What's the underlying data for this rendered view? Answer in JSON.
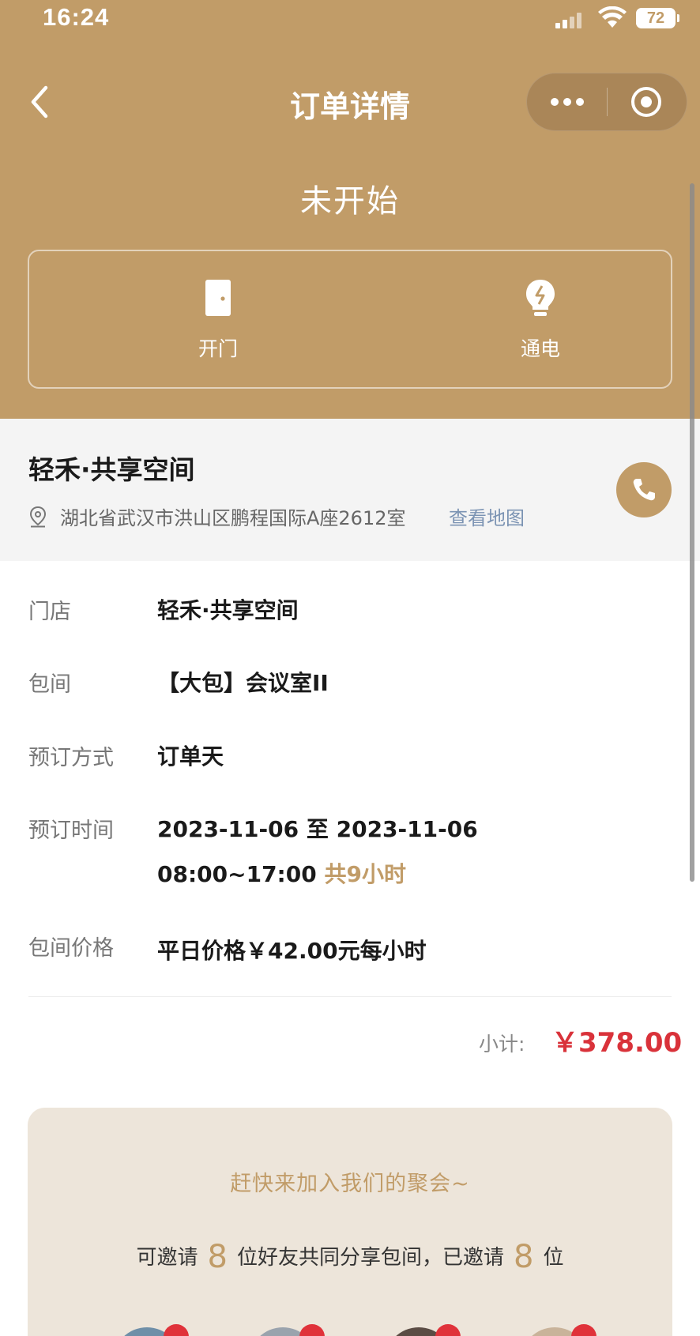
{
  "status_bar": {
    "time": "16:24",
    "battery": "72"
  },
  "nav": {
    "title": "订单详情"
  },
  "order": {
    "status": "未开始"
  },
  "controls": [
    {
      "label": "开门",
      "icon": "door-icon"
    },
    {
      "label": "通电",
      "icon": "bulb-icon"
    }
  ],
  "store": {
    "name": "轻禾·共享空间",
    "address": "湖北省武汉市洪山区鹏程国际A座2612室",
    "map_link": "查看地图"
  },
  "details": {
    "store_label": "门店",
    "store_value": "轻禾·共享空间",
    "room_label": "包间",
    "room_value": "【大包】会议室II",
    "mode_label": "预订方式",
    "mode_value": "订单天",
    "time_label": "预订时间",
    "time_range": "2023-11-06 至 2023-11-06",
    "time_hours": "08:00~17:00",
    "time_total": "共9小时",
    "price_label": "包间价格",
    "price_value": "平日价格￥42.00元每小时"
  },
  "subtotal": {
    "label": "小计:",
    "value": "￥378.00"
  },
  "invite": {
    "title": "赶快来加入我们的聚会~",
    "text_prefix": "可邀请",
    "invitable_count": "8",
    "text_middle": "位好友共同分享包间，已邀请",
    "invited_count": "8",
    "text_suffix": "位"
  },
  "colors": {
    "brand_gold": "#c19c68",
    "price_red": "#d9323a",
    "link_blue": "#7b93b3"
  }
}
